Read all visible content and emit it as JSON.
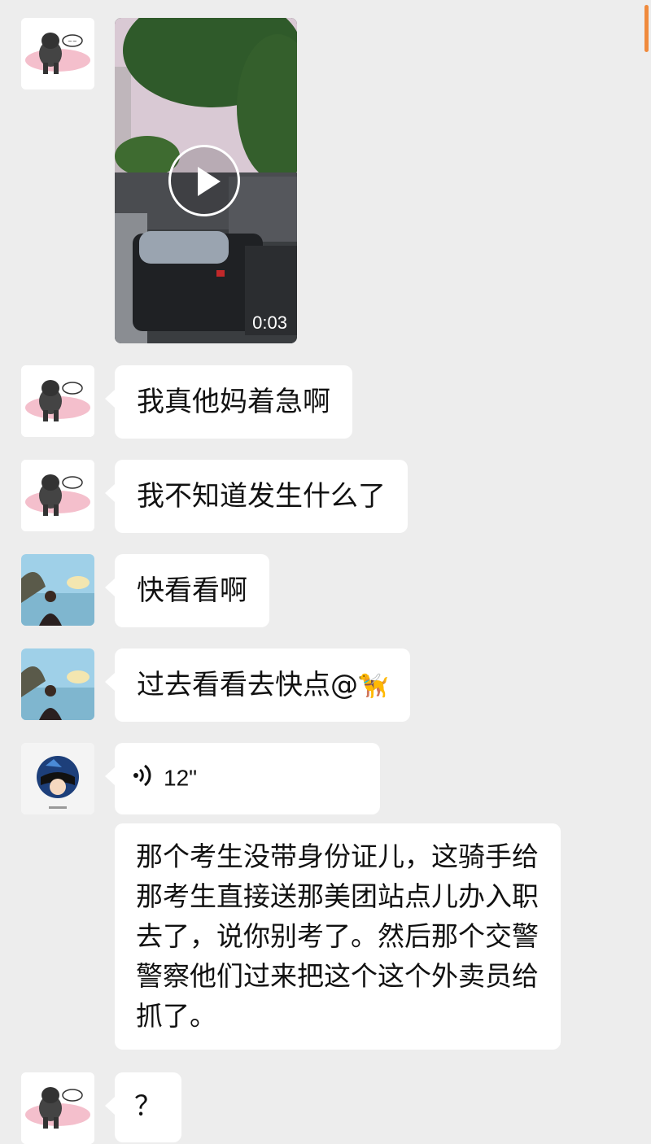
{
  "video_message": {
    "duration": "0:03"
  },
  "messages": [
    {
      "text": "我真他妈着急啊"
    },
    {
      "text": "我不知道发生什么了"
    },
    {
      "text": "快看看啊"
    },
    {
      "text": "过去看看去快点@",
      "emoji": "🦮"
    },
    {
      "voice_length": "12\""
    },
    {
      "text": "那个考生没带身份证儿，这骑手给那考生直接送那美团站点儿办入职去了，说你别考了。然后那个交警警察他们过来把这个这个外卖员给抓了。"
    },
    {
      "text": "？"
    }
  ]
}
